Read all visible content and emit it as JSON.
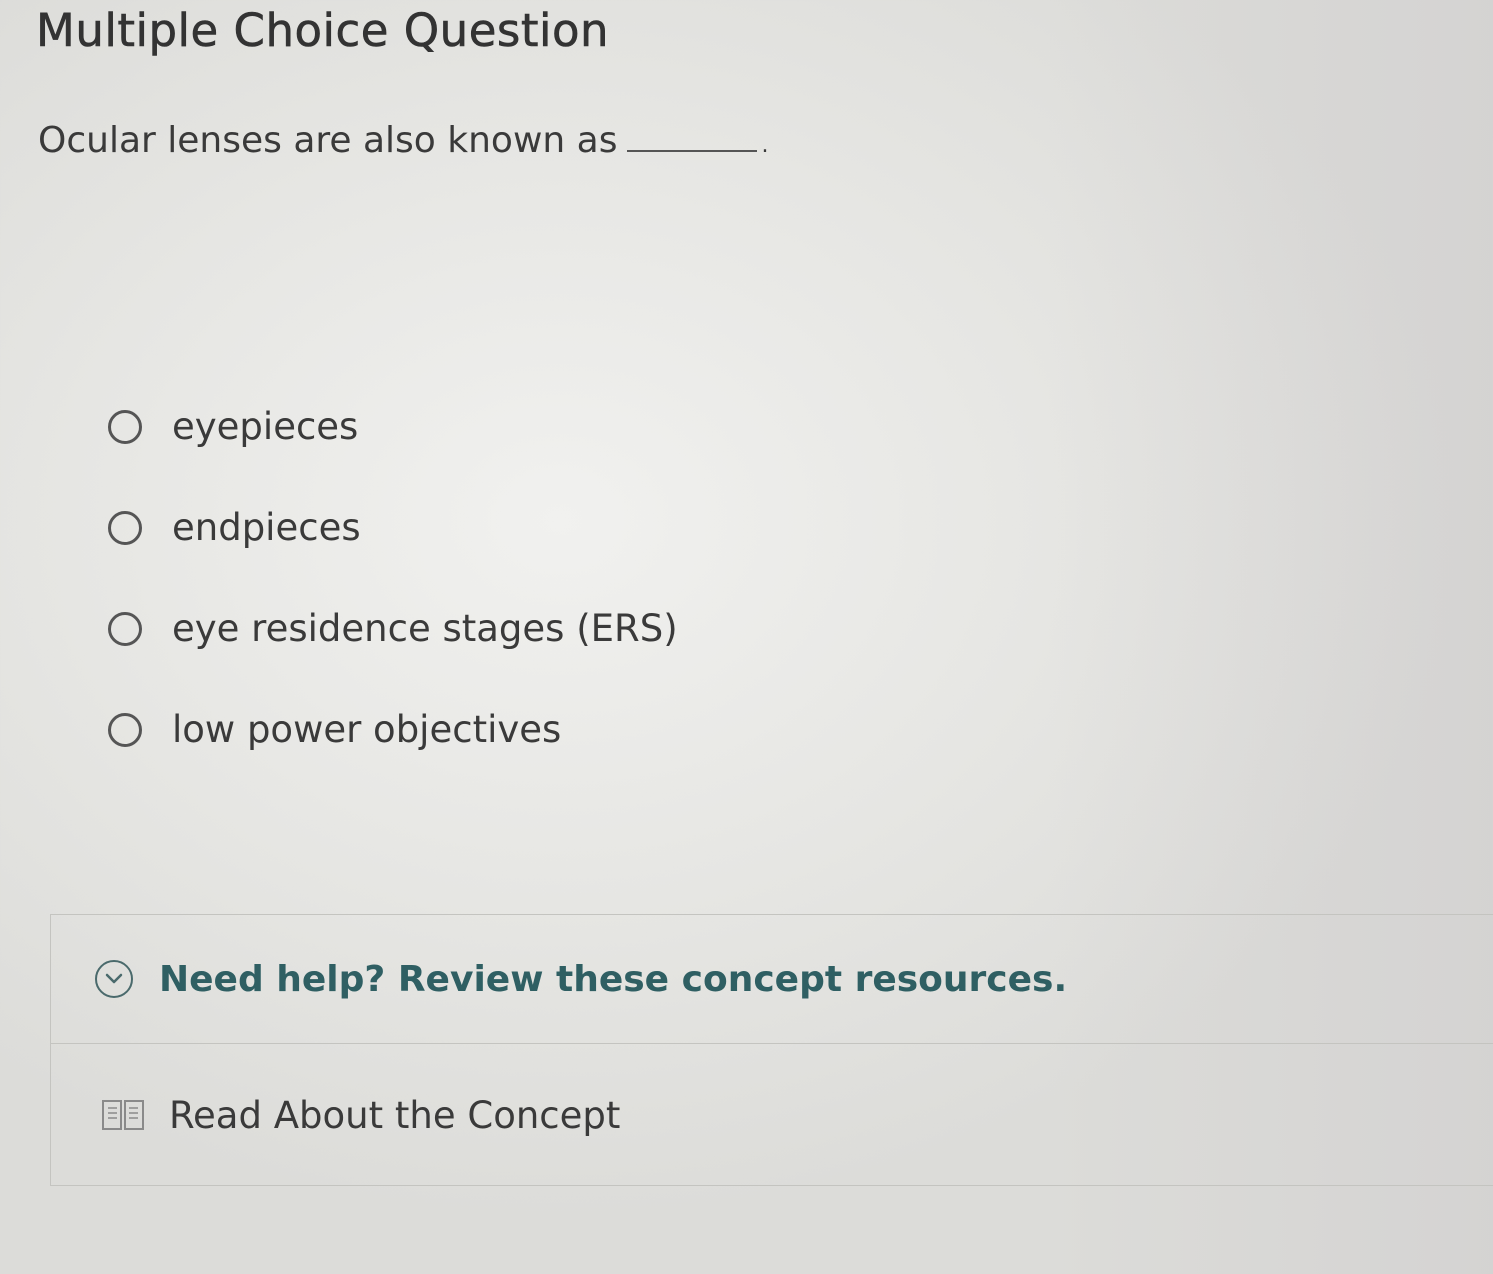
{
  "header": {
    "title": "Multiple Choice Question"
  },
  "question": {
    "prompt": "Ocular lenses are also known as",
    "suffix": "."
  },
  "options": [
    {
      "label": "eyepieces",
      "selected": false
    },
    {
      "label": "endpieces",
      "selected": false
    },
    {
      "label": "eye residence stages (ERS)",
      "selected": false
    },
    {
      "label": "low power objectives",
      "selected": false
    }
  ],
  "help": {
    "title": "Need help? Review these concept resources.",
    "icon": "chevron-down-icon",
    "expanded": true,
    "resources": [
      {
        "label": "Read About the Concept",
        "icon": "book-icon"
      }
    ]
  },
  "colors": {
    "help_title": "#2f5f63",
    "text": "#3a3a3a"
  }
}
